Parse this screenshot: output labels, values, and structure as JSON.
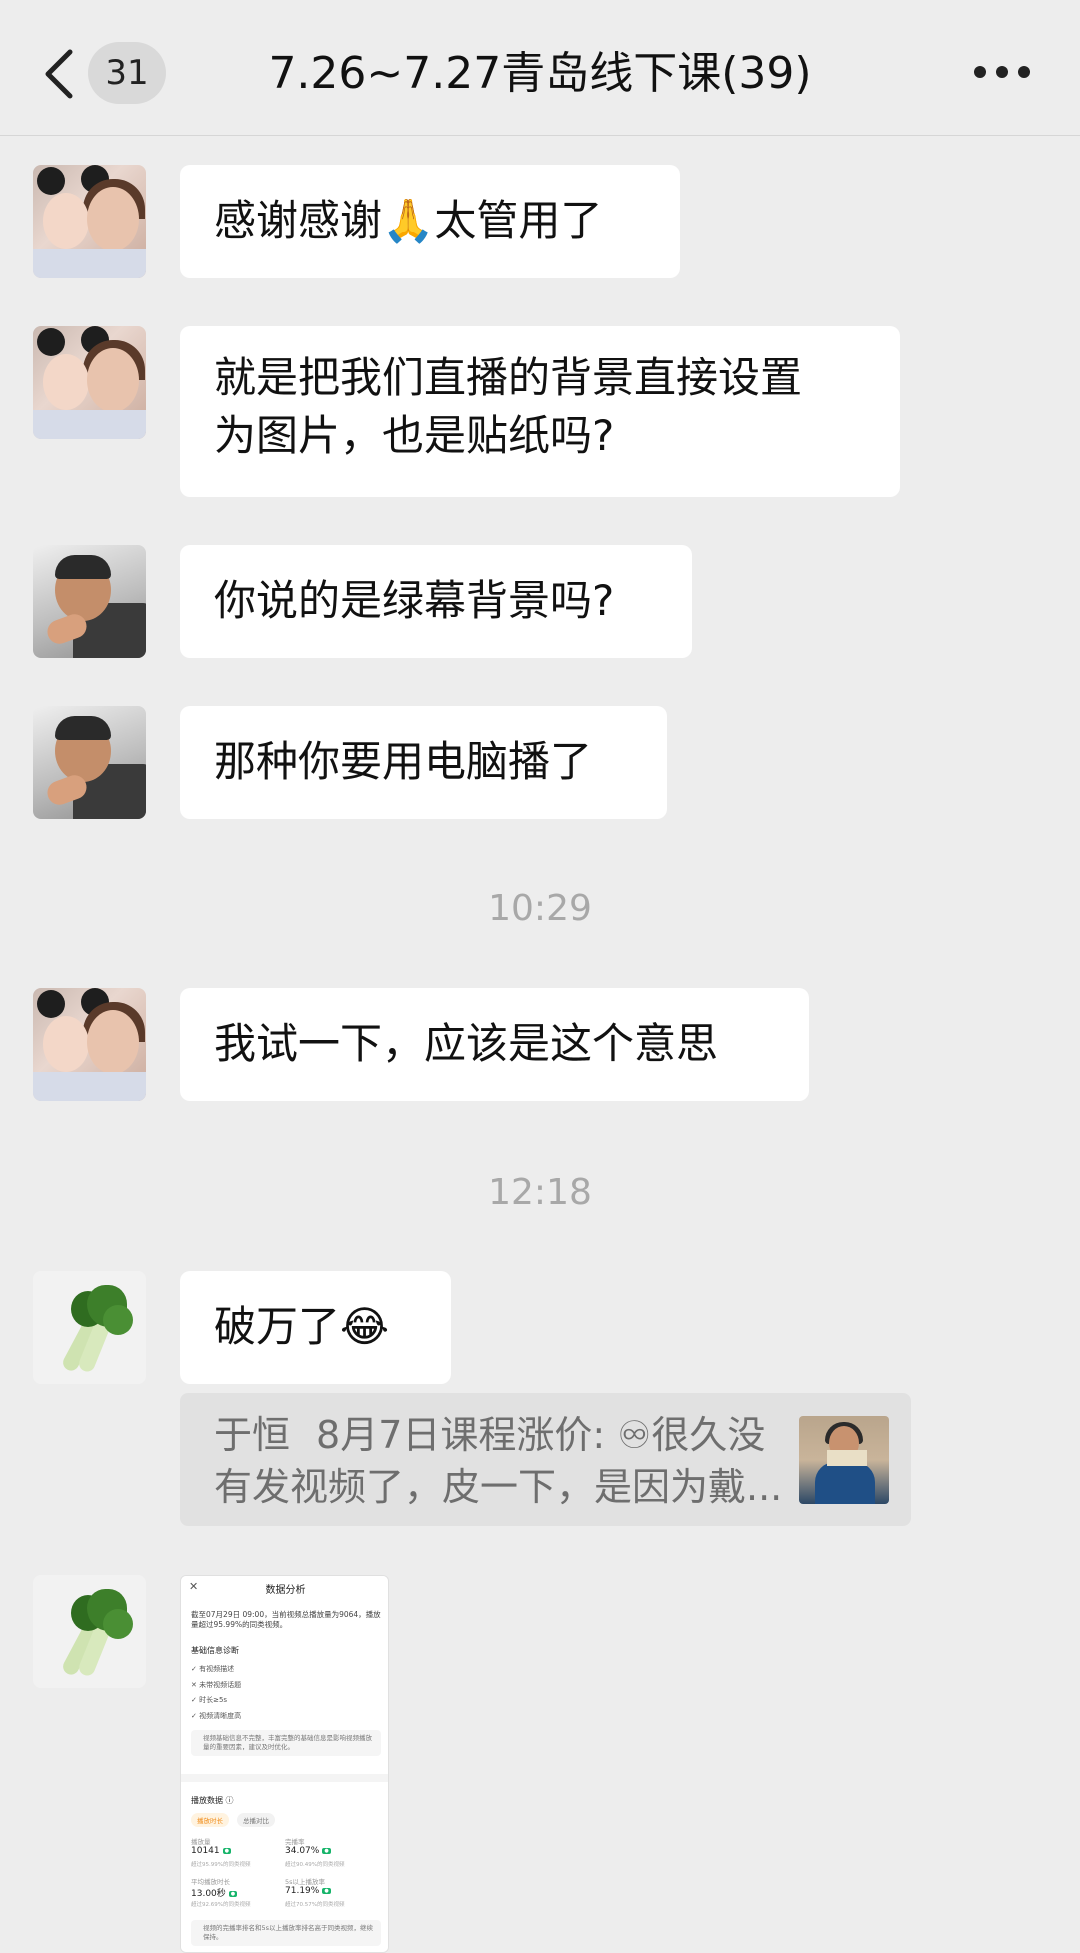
{
  "header": {
    "back_icon": "chevron-left-icon",
    "unread_count": "31",
    "title": "7.26~7.27青岛线下课(39)",
    "more_icon": "more-dots-icon"
  },
  "messages": [
    {
      "sender_avatar": "family-avatar",
      "text_before": "感谢感谢",
      "emoji": "🙏",
      "text_after": "太管用了"
    },
    {
      "sender_avatar": "family-avatar",
      "line1": "就是把我们直播的背景直接设置",
      "line2": "为图片，也是贴纸吗?"
    },
    {
      "sender_avatar": "man-avatar",
      "text": "你说的是绿幕背景吗?"
    },
    {
      "sender_avatar": "man-avatar",
      "text": "那种你要用电脑播了"
    },
    {
      "sender_avatar": "family-avatar",
      "text": "我试一下，应该是这个意思"
    },
    {
      "sender_avatar": "vegetable-avatar",
      "text": "破万了",
      "emoji": "😂"
    }
  ],
  "timestamps": [
    "10:29",
    "12:18"
  ],
  "quote": {
    "sender": "于恒",
    "line1": "8月7日课程涨价: ♾很久没",
    "line2": "有发视频了，皮一下，是因为戴..."
  },
  "screenshot": {
    "title": "数据分析",
    "intro": "截至07月29日 09:00，当前视频总播放量为9064，播放量超过95.99%的同类视频。",
    "diag_title": "基础信息诊断",
    "diag_items": [
      "✓ 有视频描述",
      "✕ 未带视频话题",
      "✓ 时长≥5s",
      "✓ 视频清晰度高"
    ],
    "diag_note": "视频基础信息不完整，丰富完整的基础信息是影响视频播放量的重要因素，建议及时优化。",
    "play_title": "播放数据 ⓘ",
    "pill1": "播放时长",
    "pill2": "总播对比",
    "metrics": [
      {
        "label": "播放量",
        "value": "10141",
        "sub": "超过95.99%的同类视频"
      },
      {
        "label": "完播率",
        "value": "34.07%",
        "sub": "超过90.49%的同类视频"
      },
      {
        "label": "平均播放时长",
        "value": "13.00秒",
        "sub": "超过92.69%的同类视频"
      },
      {
        "label": "5s以上播放率",
        "value": "71.19%",
        "sub": "超过70.57%的同类视频"
      }
    ],
    "bottom_note": "视频的完播率排名和5s以上播放率排名高于同类视频，继续保持。"
  }
}
